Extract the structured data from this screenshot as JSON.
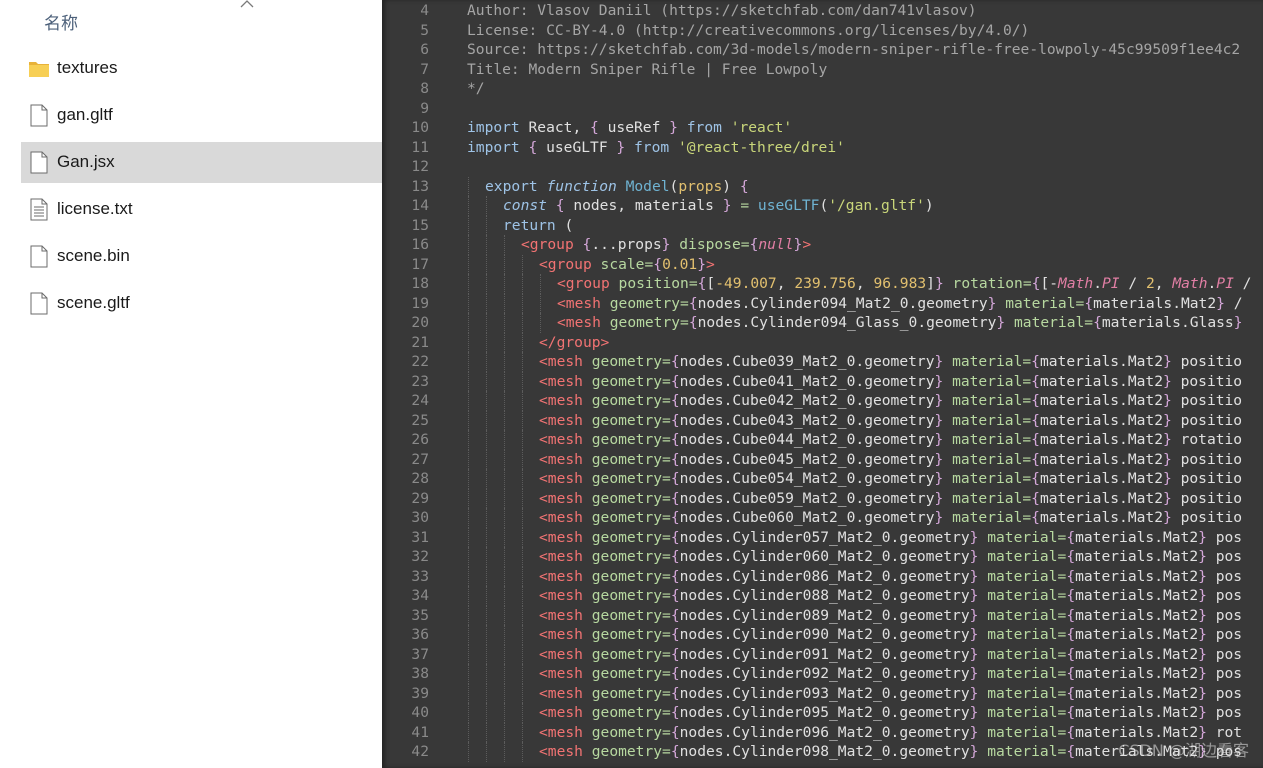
{
  "explorer": {
    "column_header": "名称",
    "files": [
      {
        "name": "textures",
        "icon": "folder-icon",
        "selected": false
      },
      {
        "name": "gan.gltf",
        "icon": "file-icon",
        "selected": false
      },
      {
        "name": "Gan.jsx",
        "icon": "file-icon",
        "selected": true
      },
      {
        "name": "license.txt",
        "icon": "text-file-icon",
        "selected": false
      },
      {
        "name": "scene.bin",
        "icon": "file-icon",
        "selected": false
      },
      {
        "name": "scene.gltf",
        "icon": "file-icon",
        "selected": false
      }
    ]
  },
  "editor": {
    "lines": [
      {
        "n": "4",
        "text": "Author: Vlasov Daniil (https://sketchfab.com/dan741vlasov)"
      },
      {
        "n": "5",
        "text": "License: CC-BY-4.0 (http://creativecommons.org/licenses/by/4.0/)"
      },
      {
        "n": "6",
        "text": "Source: https://sketchfab.com/3d-models/modern-sniper-rifle-free-lowpoly-45c99509f1ee4c2"
      },
      {
        "n": "7",
        "text": "Title: Modern Sniper Rifle | Free Lowpoly"
      },
      {
        "n": "8",
        "text": "*/"
      },
      {
        "n": "9",
        "text": ""
      },
      {
        "n": "10",
        "text": "import React, { useRef } from 'react'"
      },
      {
        "n": "11",
        "text": "import { useGLTF } from '@react-three/drei'"
      },
      {
        "n": "12",
        "text": ""
      },
      {
        "n": "13",
        "text": "export function Model(props) {"
      },
      {
        "n": "14",
        "text": "const { nodes, materials } = useGLTF('/gan.gltf')"
      },
      {
        "n": "15",
        "text": "return ("
      },
      {
        "n": "16",
        "text": "<group {...props} dispose={null}>"
      },
      {
        "n": "17",
        "text": "<group scale={0.01}>"
      },
      {
        "n": "18",
        "text": "<group position={[-49.007, 239.756, 96.983]} rotation={[-Math.PI / 2, Math.PI /"
      },
      {
        "n": "19",
        "text": "<mesh geometry={nodes.Cylinder094_Mat2_0.geometry} material={materials.Mat2} /"
      },
      {
        "n": "20",
        "text": "<mesh geometry={nodes.Cylinder094_Glass_0.geometry} material={materials.Glass}"
      },
      {
        "n": "21",
        "text": "</group>"
      },
      {
        "n": "22",
        "text": "<mesh geometry={nodes.Cube039_Mat2_0.geometry} material={materials.Mat2} positio"
      },
      {
        "n": "23",
        "text": "<mesh geometry={nodes.Cube041_Mat2_0.geometry} material={materials.Mat2} positio"
      },
      {
        "n": "24",
        "text": "<mesh geometry={nodes.Cube042_Mat2_0.geometry} material={materials.Mat2} positio"
      },
      {
        "n": "25",
        "text": "<mesh geometry={nodes.Cube043_Mat2_0.geometry} material={materials.Mat2} positio"
      },
      {
        "n": "26",
        "text": "<mesh geometry={nodes.Cube044_Mat2_0.geometry} material={materials.Mat2} rotatio"
      },
      {
        "n": "27",
        "text": "<mesh geometry={nodes.Cube045_Mat2_0.geometry} material={materials.Mat2} positio"
      },
      {
        "n": "28",
        "text": "<mesh geometry={nodes.Cube054_Mat2_0.geometry} material={materials.Mat2} positio"
      },
      {
        "n": "29",
        "text": "<mesh geometry={nodes.Cube059_Mat2_0.geometry} material={materials.Mat2} positio"
      },
      {
        "n": "30",
        "text": "<mesh geometry={nodes.Cube060_Mat2_0.geometry} material={materials.Mat2} positio"
      },
      {
        "n": "31",
        "text": "<mesh geometry={nodes.Cylinder057_Mat2_0.geometry} material={materials.Mat2} pos"
      },
      {
        "n": "32",
        "text": "<mesh geometry={nodes.Cylinder060_Mat2_0.geometry} material={materials.Mat2} pos"
      },
      {
        "n": "33",
        "text": "<mesh geometry={nodes.Cylinder086_Mat2_0.geometry} material={materials.Mat2} pos"
      },
      {
        "n": "34",
        "text": "<mesh geometry={nodes.Cylinder088_Mat2_0.geometry} material={materials.Mat2} pos"
      },
      {
        "n": "35",
        "text": "<mesh geometry={nodes.Cylinder089_Mat2_0.geometry} material={materials.Mat2} pos"
      },
      {
        "n": "36",
        "text": "<mesh geometry={nodes.Cylinder090_Mat2_0.geometry} material={materials.Mat2} pos"
      },
      {
        "n": "37",
        "text": "<mesh geometry={nodes.Cylinder091_Mat2_0.geometry} material={materials.Mat2} pos"
      },
      {
        "n": "38",
        "text": "<mesh geometry={nodes.Cylinder092_Mat2_0.geometry} material={materials.Mat2} pos"
      },
      {
        "n": "39",
        "text": "<mesh geometry={nodes.Cylinder093_Mat2_0.geometry} material={materials.Mat2} pos"
      },
      {
        "n": "40",
        "text": "<mesh geometry={nodes.Cylinder095_Mat2_0.geometry} material={materials.Mat2} pos"
      },
      {
        "n": "41",
        "text": "<mesh geometry={nodes.Cylinder096_Mat2_0.geometry} material={materials.Mat2} rot"
      },
      {
        "n": "42",
        "text": "<mesh geometry={nodes.Cylinder098_Mat2_0.geometry} material={materials.Mat2} pos"
      }
    ]
  },
  "watermark": "CSDN @湖边看客",
  "colors": {
    "editor_bg": "#383838",
    "selection_bg": "#d9d9d9",
    "folder": "#f2c44b"
  }
}
